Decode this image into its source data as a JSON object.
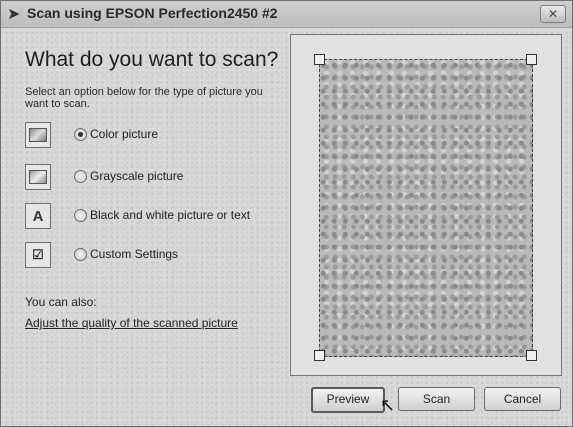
{
  "window": {
    "title": "Scan using EPSON Perfection2450 #2",
    "close_label": "✕"
  },
  "main": {
    "heading": "What do you want to scan?",
    "instructions": "Select an option below for the type of picture you want to scan.",
    "options": [
      {
        "label": "Color picture",
        "selected": true,
        "icon": "color-picture-icon"
      },
      {
        "label": "Grayscale picture",
        "selected": false,
        "icon": "grayscale-picture-icon"
      },
      {
        "label": "Black and white picture or text",
        "selected": false,
        "icon": "black-white-text-icon"
      },
      {
        "label": "Custom Settings",
        "selected": false,
        "icon": "custom-settings-icon"
      }
    ],
    "also_label": "You can also:",
    "adjust_link": "Adjust the quality of the scanned picture"
  },
  "buttons": {
    "preview": "Preview",
    "scan": "Scan",
    "cancel": "Cancel"
  }
}
